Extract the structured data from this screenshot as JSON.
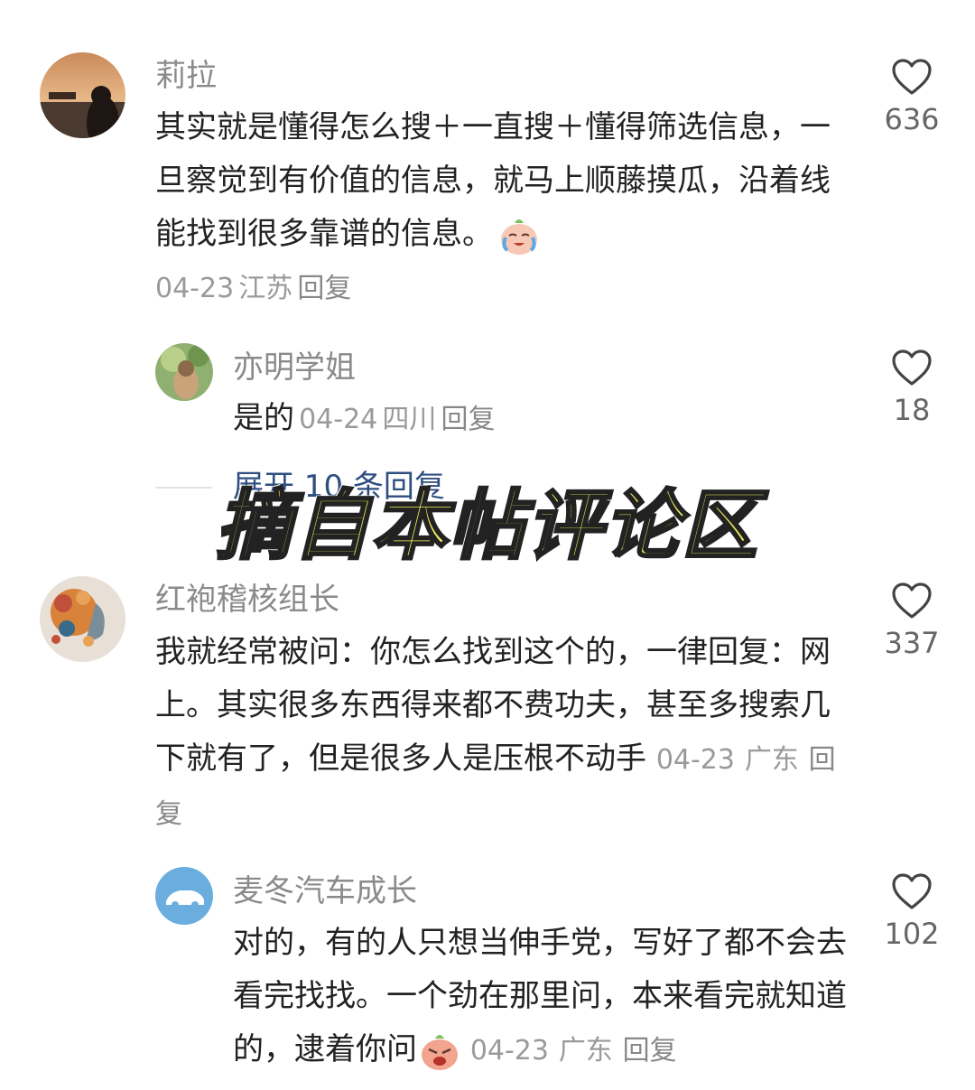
{
  "comments": [
    {
      "username": "莉拉",
      "text": "其实就是懂得怎么搜＋一直搜＋懂得筛选信息，一旦察觉到有价值的信息，就马上顺藤摸瓜，沿着线能找到很多靠谱的信息。",
      "date": "04-23",
      "location": "江苏",
      "reply_label": "回复",
      "likes": "636",
      "replies": [
        {
          "username": "亦明学姐",
          "text": "是的",
          "date": "04-24",
          "location": "四川",
          "reply_label": "回复",
          "likes": "18"
        }
      ],
      "expand_label": "展开 10 条回复"
    },
    {
      "username": "红袍稽核组长",
      "text": "我就经常被问：你怎么找到这个的，一律回复：网上。其实很多东西得来都不费功夫，甚至多搜索几下就有了，但是很多人是压根不动手",
      "date": "04-23",
      "location": "广东",
      "reply_label": "回复",
      "likes": "337",
      "replies": [
        {
          "username": "麦冬汽车成长",
          "text": "对的，有的人只想当伸手党，写好了都不会去看完找找。一个劲在那里问，本来看完就知道的，逮着你问",
          "date": "04-23",
          "location": "广东",
          "reply_label": "回复",
          "likes": "102"
        }
      ]
    }
  ],
  "overlay_caption": "摘自本帖评论区",
  "icons": {
    "like": "heart-outline-icon",
    "emoji_cry": "crying-peach-emoji",
    "emoji_angry": "angry-peach-emoji"
  },
  "colors": {
    "username": "#8a8a8a",
    "text": "#222222",
    "meta": "#9a9a9a",
    "link": "#2e4e80",
    "overlay": "#f4f25a"
  }
}
